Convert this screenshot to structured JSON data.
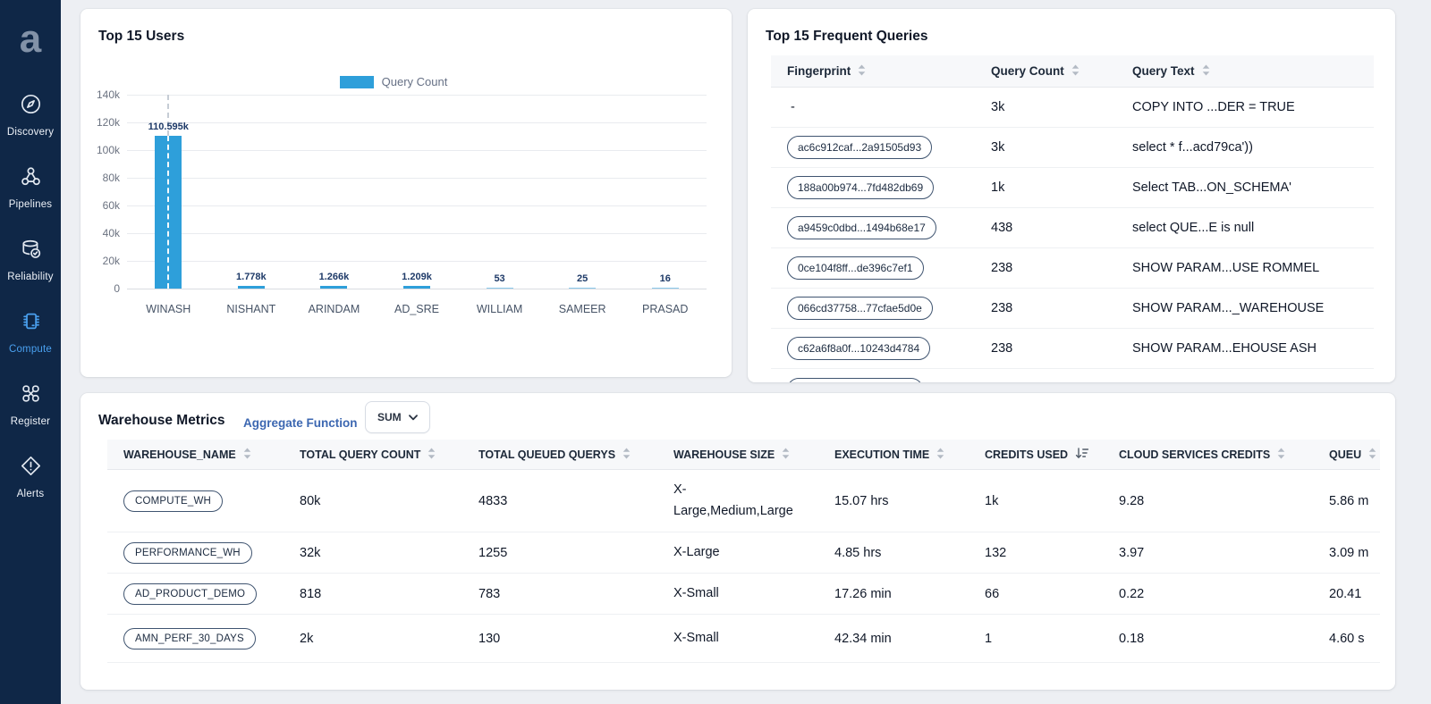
{
  "colors": {
    "sidebar_bg": "#0f2747",
    "active_blue": "#4aa0ef",
    "bar_blue": "#2e9fda",
    "bar_label_navy": "#1e3a68",
    "link_blue": "#3c67b1",
    "page_bg": "#edeff3"
  },
  "sidebar": {
    "logo_text": "a",
    "items": [
      {
        "label": "Discovery",
        "icon": "compass-icon",
        "active": false
      },
      {
        "label": "Pipelines",
        "icon": "pipelines-icon",
        "active": false
      },
      {
        "label": "Reliability",
        "icon": "database-check-icon",
        "active": false
      },
      {
        "label": "Compute",
        "icon": "chip-icon",
        "active": true
      },
      {
        "label": "Register",
        "icon": "register-nodes-icon",
        "active": false
      },
      {
        "label": "Alerts",
        "icon": "alert-diamond-icon",
        "active": false
      }
    ]
  },
  "users_card": {
    "title": "Top 15 Users"
  },
  "chart_data": {
    "type": "bar",
    "title": "Top 15 Users",
    "legend": [
      "Query Count"
    ],
    "legend_position": "top",
    "categories": [
      "WINASH",
      "NISHANT",
      "ARINDAM",
      "AD_SRE",
      "WILLIAM",
      "SAMEER",
      "PRASAD"
    ],
    "values": [
      110595,
      1778,
      1266,
      1209,
      53,
      25,
      16
    ],
    "value_labels": [
      "110.595k",
      "1.778k",
      "1.266k",
      "1.209k",
      "53",
      "25",
      "16"
    ],
    "ylim": [
      0,
      140000
    ],
    "ytick_labels": [
      "140k",
      "120k",
      "100k",
      "80k",
      "60k",
      "40k",
      "20k",
      "0"
    ],
    "grid": true,
    "bar_color": "#2e9fda",
    "highlighted_category": "WINASH"
  },
  "queries_card": {
    "title": "Top 15 Frequent Queries",
    "columns": [
      {
        "label": "Fingerprint"
      },
      {
        "label": "Query Count"
      },
      {
        "label": "Query Text"
      }
    ],
    "rows": [
      {
        "fingerprint": "-",
        "pill": false,
        "query_count": "3k",
        "query_text": "COPY INTO ...DER = TRUE"
      },
      {
        "fingerprint": "ac6c912caf...2a91505d93",
        "pill": true,
        "query_count": "3k",
        "query_text": "select * f...acd79ca'))"
      },
      {
        "fingerprint": "188a00b974...7fd482db69",
        "pill": true,
        "query_count": "1k",
        "query_text": "Select TAB...ON_SCHEMA'"
      },
      {
        "fingerprint": "a9459c0dbd...1494b68e17",
        "pill": true,
        "query_count": "438",
        "query_text": "select QUE...E is null"
      },
      {
        "fingerprint": "0ce104f8ff...de396c7ef1",
        "pill": true,
        "query_count": "238",
        "query_text": "SHOW PARAM...USE ROMMEL"
      },
      {
        "fingerprint": "066cd37758...77cfae5d0e",
        "pill": true,
        "query_count": "238",
        "query_text": "SHOW PARAM..._WAREHOUSE"
      },
      {
        "fingerprint": "c62a6f8a0f...10243d4784",
        "pill": true,
        "query_count": "238",
        "query_text": "SHOW PARAM...EHOUSE ASH"
      }
    ]
  },
  "warehouse_card": {
    "title": "Warehouse Metrics",
    "aggregate_function_label": "Aggregate Function",
    "aggregate_selected": "SUM",
    "columns": [
      {
        "label": "WAREHOUSE_NAME",
        "sort": "both"
      },
      {
        "label": "TOTAL QUERY COUNT",
        "sort": "both"
      },
      {
        "label": "TOTAL QUEUED QUERYS",
        "sort": "both"
      },
      {
        "label": "WAREHOUSE SIZE",
        "sort": "both"
      },
      {
        "label": "EXECUTION TIME",
        "sort": "both"
      },
      {
        "label": "CREDITS USED",
        "sort": "desc"
      },
      {
        "label": "CLOUD SERVICES CREDITS",
        "sort": "both"
      },
      {
        "label": "QUEU",
        "sort": "both"
      }
    ],
    "rows": [
      {
        "name": "COMPUTE_WH",
        "total_query_count": "80k",
        "total_queued_querys": "4833",
        "warehouse_size": "X-Large,Medium,Large",
        "execution_time": "15.07 hrs",
        "credits_used": "1k",
        "cloud_services_credits": "9.28",
        "queued": "5.86 m"
      },
      {
        "name": "PERFORMANCE_WH",
        "total_query_count": "32k",
        "total_queued_querys": "1255",
        "warehouse_size": "X-Large",
        "execution_time": "4.85 hrs",
        "credits_used": "132",
        "cloud_services_credits": "3.97",
        "queued": "3.09 m"
      },
      {
        "name": "AD_PRODUCT_DEMO",
        "total_query_count": "818",
        "total_queued_querys": "783",
        "warehouse_size": "X-Small",
        "execution_time": "17.26 min",
        "credits_used": "66",
        "cloud_services_credits": "0.22",
        "queued": "20.41"
      },
      {
        "name": "AMN_PERF_30_DAYS",
        "total_query_count": "2k",
        "total_queued_querys": "130",
        "warehouse_size": "X-Small",
        "execution_time": "42.34 min",
        "credits_used": "1",
        "cloud_services_credits": "0.18",
        "queued": "4.60 s"
      }
    ]
  }
}
